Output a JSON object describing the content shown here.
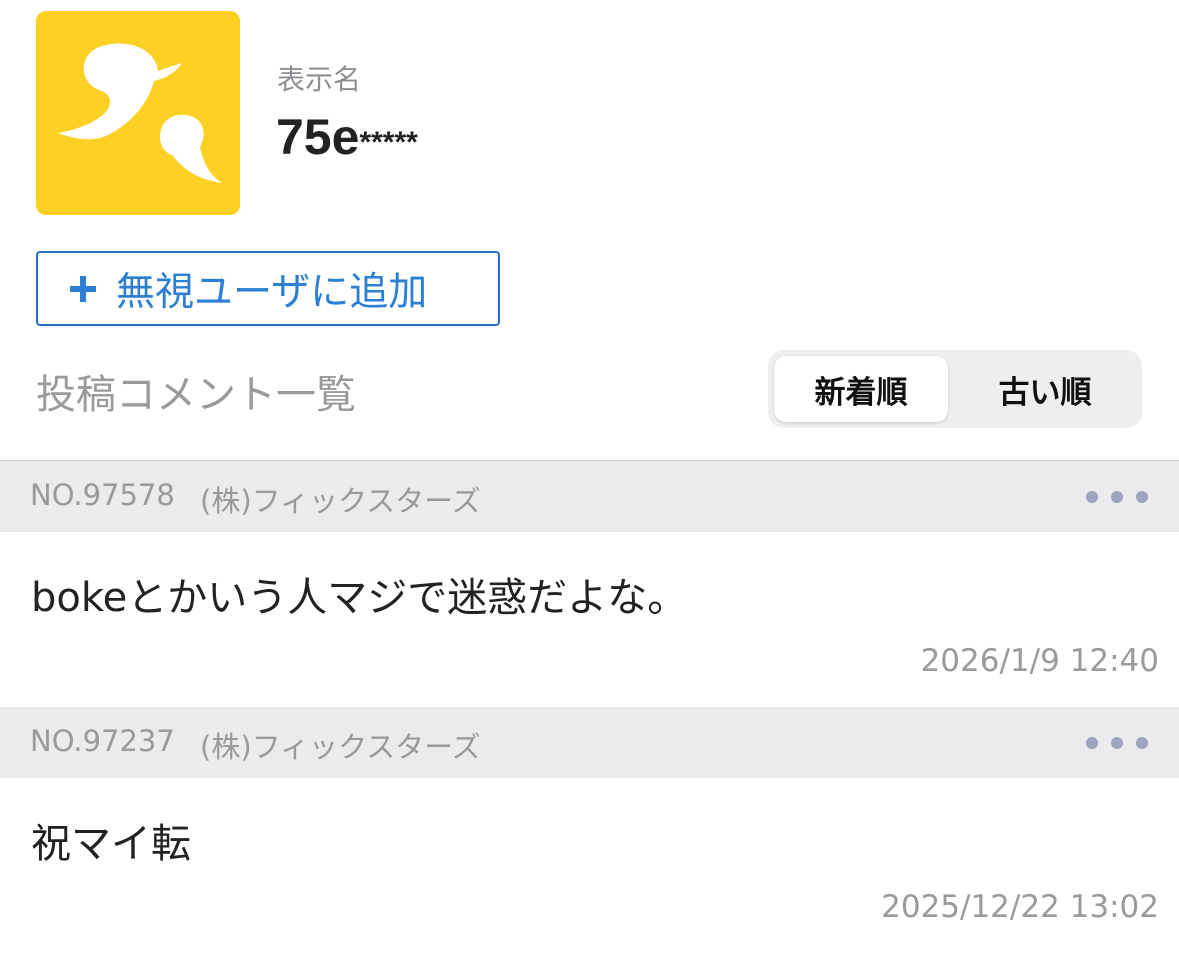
{
  "profile": {
    "avatar_icon": "speech-bubbles-icon",
    "avatar_color": "#fdd023",
    "name_label": "表示名",
    "name_prefix": "75e",
    "name_mask": "*****"
  },
  "actions": {
    "ignore_label": "無視ユーザに追加",
    "ignore_icon": "plus-icon",
    "accent_color": "#2b7fd4"
  },
  "comments_section": {
    "title": "投稿コメント一覧",
    "sort": {
      "newest_label": "新着順",
      "oldest_label": "古い順",
      "selected": "新着順"
    }
  },
  "comments": [
    {
      "number": "NO.97578",
      "company": "(株)フィックスターズ",
      "body": "bokeとかいう人マジで迷惑だよな。",
      "timestamp": "2026/1/9 12:40"
    },
    {
      "number": "NO.97237",
      "company": "(株)フィックスターズ",
      "body": "祝マイ転",
      "timestamp": "2025/12/22 13:02"
    }
  ]
}
